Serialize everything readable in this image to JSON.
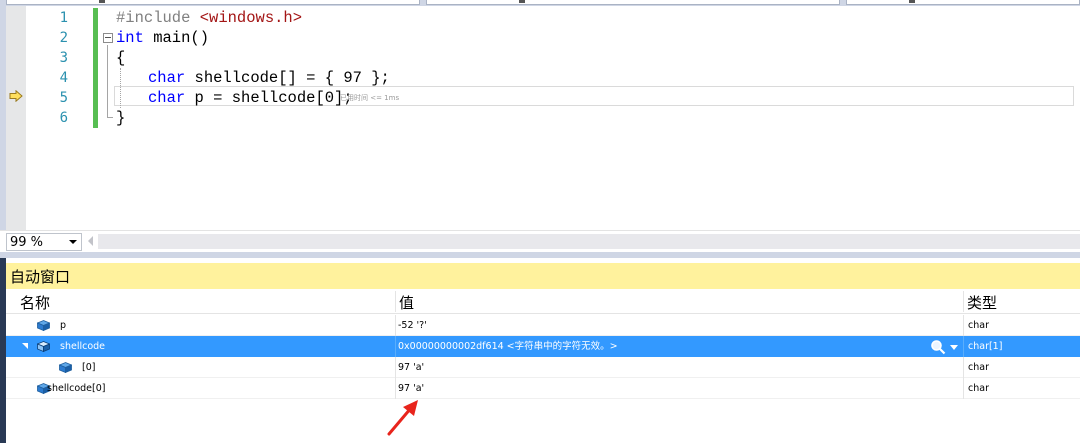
{
  "editor": {
    "line_numbers": [
      "1",
      "2",
      "3",
      "4",
      "5",
      "6"
    ],
    "lines": {
      "l1": {
        "pp": "#include ",
        "inc": "<windows.h>"
      },
      "l2": {
        "kw": "int",
        "rest": " main()"
      },
      "l3": "{",
      "l4": {
        "kw": "char",
        "rest": " shellcode[] = { 97 };"
      },
      "l5": {
        "kw": "char",
        "rest": " p = shellcode[0];"
      },
      "l6": "}"
    },
    "perf_tip": "已用时间 <= 1ms",
    "zoom": "99 %",
    "current_line_marker": "execution-pointer-arrow"
  },
  "autos": {
    "title": "自动窗口",
    "columns": {
      "name": "名称",
      "value": "值",
      "type": "类型"
    },
    "rows": [
      {
        "name": "p",
        "value": "-52 '?'",
        "type": "char"
      },
      {
        "name": "shellcode",
        "value": "0x00000000002df614 <字符串中的字符无效。>",
        "type": "char[1]"
      },
      {
        "name": "[0]",
        "value": "97 'a'",
        "type": "char"
      },
      {
        "name": "shellcode[0]",
        "value": "97 'a'",
        "type": "char"
      }
    ]
  },
  "colors": {
    "accent_selection": "#3399ff",
    "title_bar": "#fff29d",
    "keyword": "#0000ff",
    "line_number": "#2b91af",
    "include_string": "#a31515",
    "annotation_arrow": "#e8241c"
  }
}
